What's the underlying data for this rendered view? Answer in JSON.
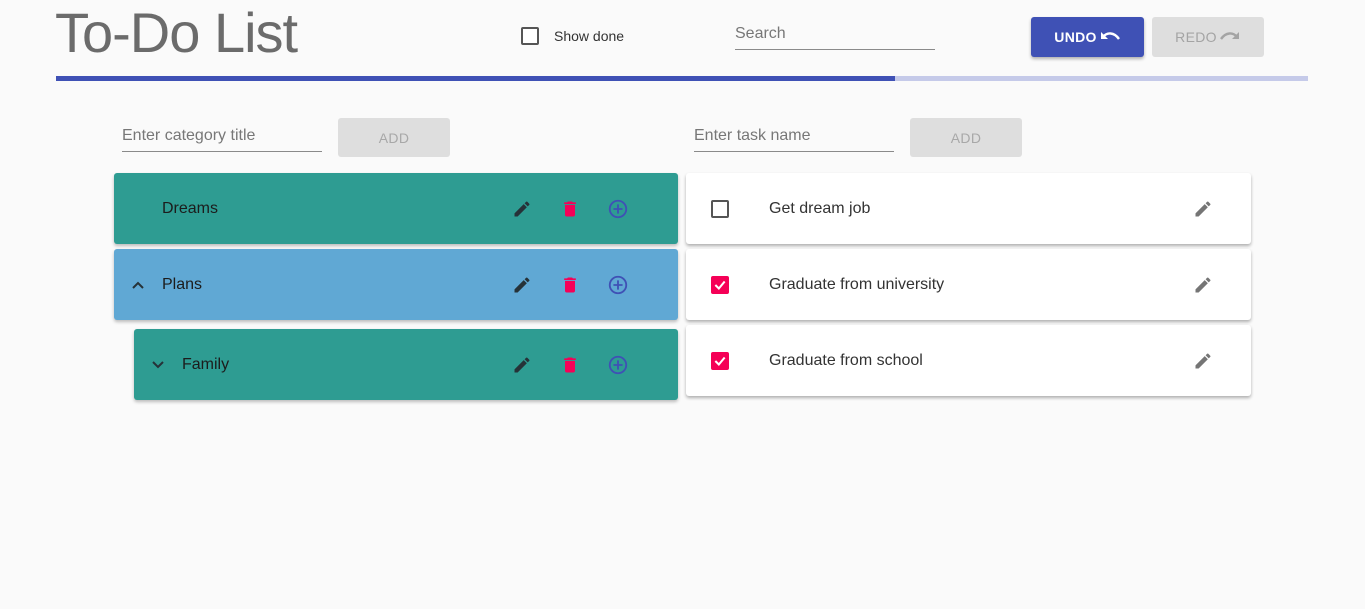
{
  "header": {
    "title": "To-Do List",
    "show_done_label": "Show done",
    "show_done_checked": false,
    "search_placeholder": "Search",
    "undo_label": "UNDO",
    "redo_label": "REDO",
    "progress_fraction": 0.67
  },
  "category_form": {
    "placeholder": "Enter category title",
    "add_label": "ADD"
  },
  "task_form": {
    "placeholder": "Enter task name",
    "add_label": "ADD"
  },
  "categories": [
    {
      "name": "Dreams",
      "expander": "none"
    },
    {
      "name": "Plans",
      "expander": "chevron-up",
      "selected": true
    },
    {
      "name": "Family",
      "expander": "chevron-down"
    }
  ],
  "tasks": [
    {
      "name": "Get dream job",
      "done": false
    },
    {
      "name": "Graduate from university",
      "done": true
    },
    {
      "name": "Graduate from school",
      "done": true
    }
  ],
  "colors": {
    "primary": "#3f51b5",
    "accent": "#f50057",
    "category": "#2e9c92",
    "category_selected": "#60a8d4"
  },
  "icons": [
    "undo-icon",
    "redo-icon",
    "pencil-icon",
    "trash-icon",
    "add-circle-icon",
    "chevron-up-icon",
    "chevron-down-icon",
    "check-icon"
  ]
}
